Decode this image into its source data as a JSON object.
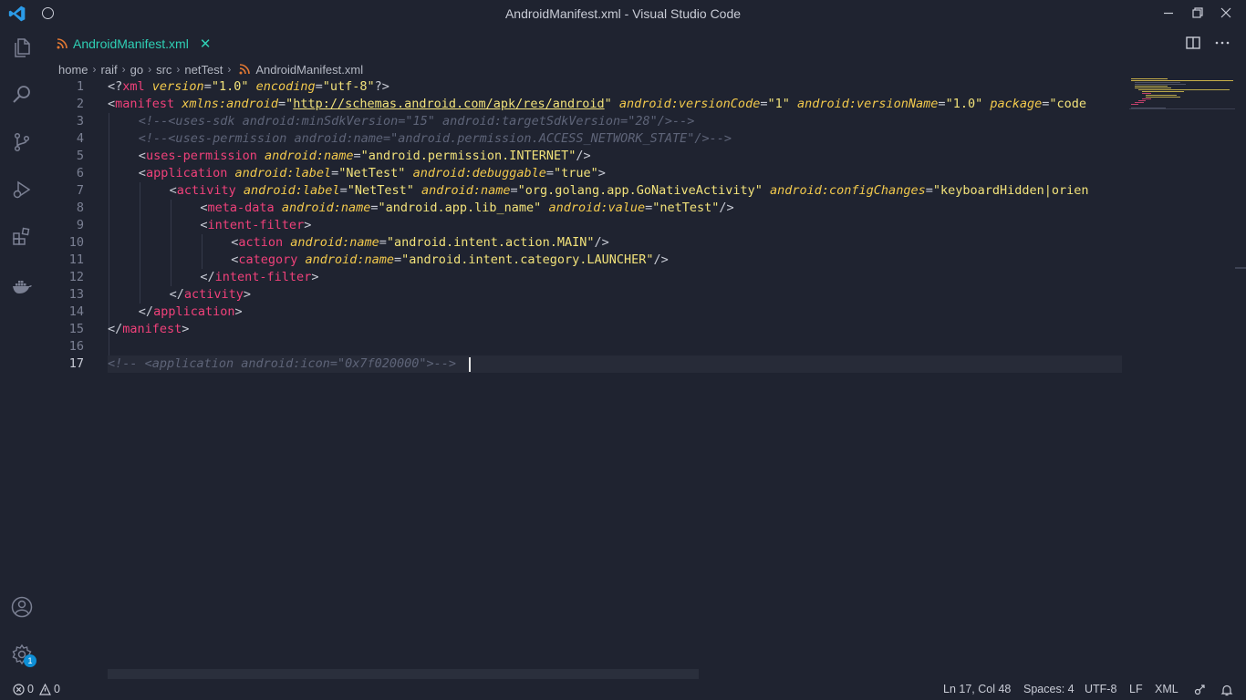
{
  "window": {
    "title": "AndroidManifest.xml - Visual Studio Code"
  },
  "tab": {
    "label": "AndroidManifest.xml",
    "close": "✕"
  },
  "breadcrumb": {
    "items": [
      "home",
      "raif",
      "go",
      "src",
      "netTest"
    ],
    "file": "AndroidManifest.xml"
  },
  "editor": {
    "current_line": 17,
    "lines": [
      {
        "n": "1"
      },
      {
        "n": "2"
      },
      {
        "n": "3"
      },
      {
        "n": "4"
      },
      {
        "n": "5"
      },
      {
        "n": "6"
      },
      {
        "n": "7"
      },
      {
        "n": "8"
      },
      {
        "n": "9"
      },
      {
        "n": "10"
      },
      {
        "n": "11"
      },
      {
        "n": "12"
      },
      {
        "n": "13"
      },
      {
        "n": "14"
      },
      {
        "n": "15"
      },
      {
        "n": "16"
      },
      {
        "n": "17"
      }
    ],
    "tokens": {
      "l1": [
        "<?",
        "xml",
        " version",
        "=",
        "\"1.0\"",
        " encoding",
        "=",
        "\"utf-8\"",
        "?>"
      ],
      "l2": [
        "<",
        "manifest",
        " xmlns:android",
        "=",
        "\"",
        "http://schemas.android.com/apk/res/android",
        "\"",
        " android:versionCode",
        "=",
        "\"1\"",
        " android:versionName",
        "=",
        "\"1.0\"",
        " package",
        "=",
        "\"code"
      ],
      "l3": "<!--<uses-sdk android:minSdkVersion=\"15\" android:targetSdkVersion=\"28\"/>-->",
      "l4": "<!--<uses-permission android:name=\"android.permission.ACCESS_NETWORK_STATE\"/>-->",
      "l5": [
        "<",
        "uses-permission",
        " android:name",
        "=",
        "\"android.permission.INTERNET\"",
        "/>"
      ],
      "l6": [
        "<",
        "application",
        " android:label",
        "=",
        "\"NetTest\"",
        " android:debuggable",
        "=",
        "\"true\"",
        ">"
      ],
      "l7": [
        "<",
        "activity",
        " android:label",
        "=",
        "\"NetTest\"",
        " android:name",
        "=",
        "\"org.golang.app.GoNativeActivity\"",
        " android:configChanges",
        "=",
        "\"keyboardHidden|orien"
      ],
      "l8": [
        "<",
        "meta-data",
        " android:name",
        "=",
        "\"android.app.lib_name\"",
        " android:value",
        "=",
        "\"netTest\"",
        "/>"
      ],
      "l9": [
        "<",
        "intent-filter",
        ">"
      ],
      "l10": [
        "<",
        "action",
        " android:name",
        "=",
        "\"android.intent.action.MAIN\"",
        "/>"
      ],
      "l11": [
        "<",
        "category",
        " android:name",
        "=",
        "\"android.intent.category.LAUNCHER\"",
        "/>"
      ],
      "l12": [
        "</",
        "intent-filter",
        ">"
      ],
      "l13": [
        "</",
        "activity",
        ">"
      ],
      "l14": [
        "</",
        "application",
        ">"
      ],
      "l15": [
        "</",
        "manifest",
        ">"
      ],
      "l17": "<!-- <application android:icon=\"0x7f020000\">-->"
    }
  },
  "statusbar": {
    "errors": "0",
    "warnings": "0",
    "position": "Ln 17, Col 48",
    "spaces": "Spaces: 4",
    "encoding": "UTF-8",
    "eol": "LF",
    "language": "XML"
  },
  "activitybar": {
    "settings_badge": "1"
  },
  "colors": {
    "background": "#1f2330",
    "tag": "#f0417a",
    "attribute": "#f2c94c",
    "string": "#f2e27a",
    "comment": "#5e6478",
    "tab_active": "#2fd0b5"
  },
  "icons": [
    "vscode-logo-icon",
    "files-icon",
    "search-icon",
    "source-control-icon",
    "run-debug-icon",
    "extensions-icon",
    "docker-icon",
    "account-icon",
    "gear-icon",
    "split-editor-icon",
    "more-actions-icon",
    "rss-file-icon",
    "error-icon",
    "warning-icon",
    "feedback-icon",
    "bell-icon"
  ]
}
